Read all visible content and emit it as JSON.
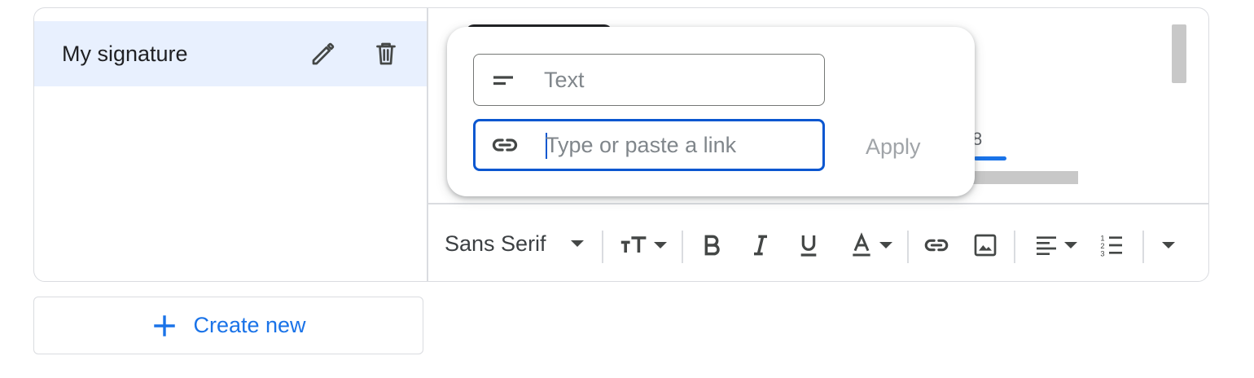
{
  "signatures": {
    "items": [
      {
        "label": "My signature"
      }
    ]
  },
  "editor": {
    "background_fragment": "8"
  },
  "link_popup": {
    "text_placeholder": "Text",
    "link_placeholder": "Type or paste a link",
    "apply_label": "Apply"
  },
  "toolbar": {
    "font_family": "Sans Serif",
    "icons": [
      "font-size-icon",
      "bold-icon",
      "italic-icon",
      "underline-icon",
      "text-color-icon",
      "link-icon",
      "image-icon",
      "align-icon",
      "numbered-list-icon",
      "more-formatting-icon"
    ]
  },
  "create_new": {
    "label": "Create new"
  },
  "colors": {
    "selected_bg": "#e8f0fe",
    "accent_blue": "#1a73e8",
    "focus_blue": "#0b57d0",
    "border": "#dadce0"
  }
}
